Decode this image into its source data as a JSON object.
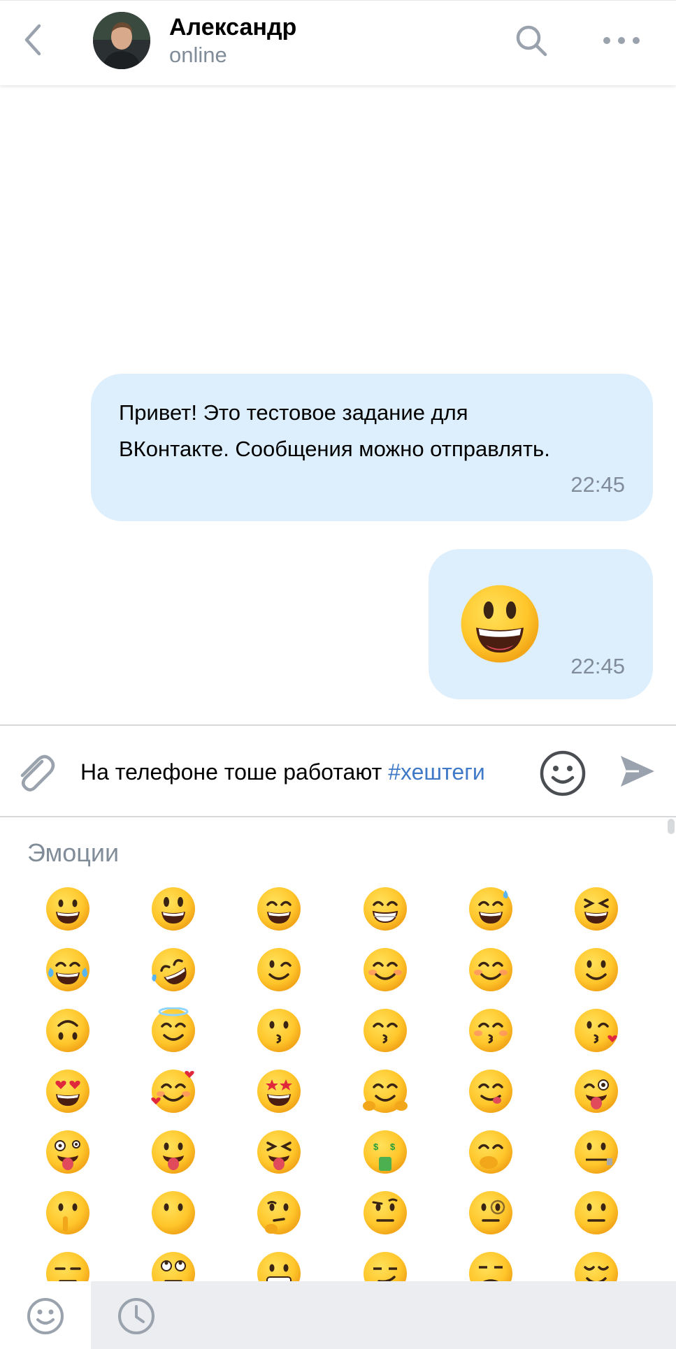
{
  "header": {
    "name": "Александр",
    "status": "online",
    "icons": {
      "back": "chevron-left-icon",
      "search": "search-icon",
      "more": "more-horizontal-icon"
    }
  },
  "messages": [
    {
      "text": "Привет! Это тестовое задание для ВКонтакте. Сообщения можно отправлять.",
      "time": "22:45"
    },
    {
      "emoji": "smiling-face-big-eyes",
      "time": "22:45"
    }
  ],
  "composer": {
    "text": "На телефоне тоше работают ",
    "hashtag": "#хештеги",
    "icons": {
      "attach": "paperclip-icon",
      "emoji": "smile-icon",
      "send": "send-icon"
    }
  },
  "emoji_panel": {
    "title": "Эмоции",
    "rows": [
      [
        "grinning",
        "big-eyes-smile",
        "grin-smiling-eyes",
        "beaming",
        "grin-sweat",
        "squinting-laugh"
      ],
      [
        "tears-of-joy",
        "rolling-on-floor",
        "winking",
        "smiling-eyes",
        "blush",
        "slight-smile"
      ],
      [
        "upside-down",
        "halo",
        "kissing",
        "kissing-smiling-eyes",
        "kissing-closed-eyes",
        "blowing-kiss"
      ],
      [
        "heart-eyes",
        "hearts-smile",
        "star-struck",
        "hugging",
        "savoring-food",
        "winking-tongue"
      ],
      [
        "zany",
        "tongue-out",
        "squinting-tongue",
        "money-mouth",
        "hand-over-mouth",
        "zipper-mouth"
      ],
      [
        "shushing",
        "no-mouth",
        "thinking",
        "raised-eyebrow",
        "monocle",
        "neutral"
      ],
      [
        "expressionless",
        "rolling-eyes",
        "grimacing",
        "smirking",
        "unamused",
        "relieved"
      ]
    ]
  },
  "bottom_bar": {
    "tabs": [
      {
        "name": "emoji-tab",
        "icon": "smile-icon",
        "active": true
      },
      {
        "name": "recent-tab",
        "icon": "clock-icon",
        "active": false
      }
    ]
  },
  "colors": {
    "bubble": "#ddeefc",
    "secondary_text": "#818c99",
    "icon_gray": "#99a2ad",
    "hashtag": "#3f79c8",
    "bottom_inactive": "#ebedf0",
    "emoji_yellow": "#ffcb3d"
  }
}
